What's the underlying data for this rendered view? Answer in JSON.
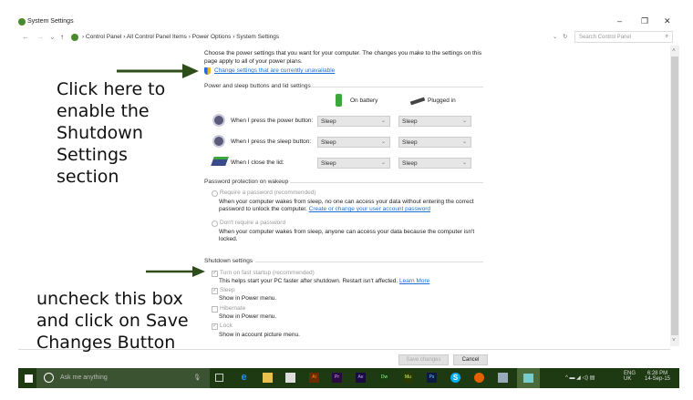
{
  "window": {
    "title": "System Settings",
    "controls": {
      "minimize": "–",
      "maximize": "❐",
      "close": "✕"
    }
  },
  "address": {
    "back": "←",
    "forward": "→",
    "recent": "⌄",
    "up": "↑",
    "breadcrumbs": [
      "Control Panel",
      "All Control Panel Items",
      "Power Options",
      "System Settings"
    ],
    "separator": "›",
    "dropdown": "⌄",
    "refresh": "↻",
    "search_placeholder": "Search Control Panel",
    "search_icon": "⌕"
  },
  "intro": {
    "text1": "Choose the power settings that you want for your computer. The changes you make to the settings on this",
    "text2": "page apply to all of your power plans.",
    "change_link": "Change settings that are currently unavailable"
  },
  "power": {
    "heading": "Power and sleep buttons and lid settings",
    "col_battery": "On battery",
    "col_plugged": "Plugged in",
    "rows": [
      {
        "label": "When I press the power button:",
        "battery": "Sleep",
        "plugged": "Sleep"
      },
      {
        "label": "When I press the sleep button:",
        "battery": "Sleep",
        "plugged": "Sleep"
      },
      {
        "label": "When I close the lid:",
        "battery": "Sleep",
        "plugged": "Sleep"
      }
    ]
  },
  "password": {
    "heading": "Password protection on wakeup",
    "opt1": "Require a password (recommended)",
    "opt1_desc1": "When your computer wakes from sleep, no one can access your data without entering the correct",
    "opt1_desc2": "password to unlock the computer.",
    "opt1_link": "Create or change your user account password",
    "opt2": "Don't require a password",
    "opt2_desc1": "When your computer wakes from sleep, anyone can access your data because the computer isn't",
    "opt2_desc2": "locked."
  },
  "shutdown": {
    "heading": "Shutdown settings",
    "items": [
      {
        "label": "Turn on fast startup (recommended)",
        "desc": "This helps start your PC faster after shutdown. Restart isn't affected.",
        "link": "Learn More",
        "checked": true
      },
      {
        "label": "Sleep",
        "desc": "Show in Power menu.",
        "checked": true
      },
      {
        "label": "Hibernate",
        "desc": "Show in Power menu.",
        "checked": false
      },
      {
        "label": "Lock",
        "desc": "Show in account picture menu.",
        "checked": true
      }
    ]
  },
  "footer": {
    "save": "Save changes",
    "cancel": "Cancel"
  },
  "annotations": {
    "top": [
      "Click here to",
      "enable the",
      "Shutdown",
      "Settings",
      "section"
    ],
    "bottom": [
      "uncheck this box",
      "and click on Save",
      "Changes Button"
    ],
    "arrow_color": "#2e4d1a"
  },
  "taskbar": {
    "search_placeholder": "Ask me anything",
    "apps": [
      "Ai",
      "Pr",
      "Ae",
      "Dw",
      "Mu",
      "Ps",
      "S"
    ],
    "lang1": "ENG",
    "lang2": "UK",
    "time": "6:28 PM",
    "date": "14-Sep-15",
    "tray_icons": "^ ▬ ◢ ◁) ▤"
  }
}
